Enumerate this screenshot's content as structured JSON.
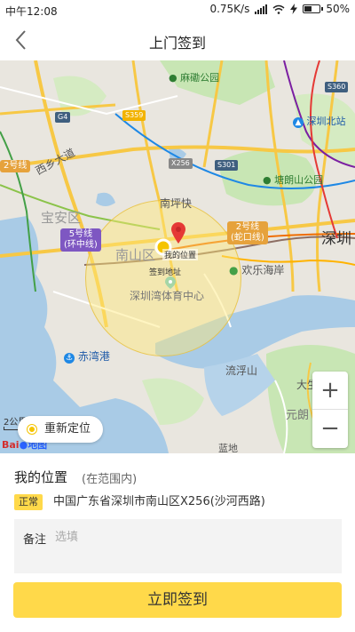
{
  "status_bar": {
    "time": "中午12:08",
    "network_speed": "0.75K/s",
    "battery_percent": "50%",
    "battery_level": 0.5,
    "icons": [
      "signal-icon",
      "wifi-icon",
      "charging-icon",
      "battery-icon"
    ]
  },
  "header": {
    "title": "上门签到",
    "back_icon": "chevron-left-icon"
  },
  "map": {
    "labels": {
      "park1": "麻磡公园",
      "station": "深圳北站",
      "road1": "西乡大道",
      "line2_left": "2号线",
      "park2": "塘朗山公园",
      "area1": "宝安区",
      "nanping": "南坪快",
      "district": "南山区",
      "city": "深圳",
      "line5": "5号线",
      "line5_sub": "(环中线)",
      "line2": "2号线",
      "line2_sub": "(蛇口线)",
      "coast": "欢乐海岸",
      "stadium": "深圳湾体育中心",
      "port": "赤湾港",
      "liufu": "流浮山",
      "yuanlang": "元朗",
      "dasheng": "大生",
      "shanbei": "蓝地",
      "my_location": "我的位置",
      "checkin_address": "签到地址"
    },
    "road_tags": {
      "g4": "G4",
      "s359": "S359",
      "x256": "X256",
      "s301": "S301",
      "s360": "S360"
    },
    "scale": "2公里",
    "logo_left": "Bai",
    "logo_right": "地图",
    "relocate_label": "重新定位",
    "zoom_in_label": "+",
    "zoom_out_label": "−"
  },
  "panel": {
    "location_title": "我的位置",
    "location_range": "(在范围内)",
    "status": "正常",
    "address": "中国广东省深圳市南山区X256(沙河西路)",
    "remark_label": "备注",
    "remark_placeholder": "选填",
    "remark_value": "",
    "submit_label": "立即签到"
  },
  "colors": {
    "accent": "#ffd94a",
    "map_water": "#a9cbe6",
    "map_land": "#e9e6df",
    "map_green": "#c8e6b4",
    "marker_red": "#e53935",
    "marker_yellow": "#f5c400"
  }
}
